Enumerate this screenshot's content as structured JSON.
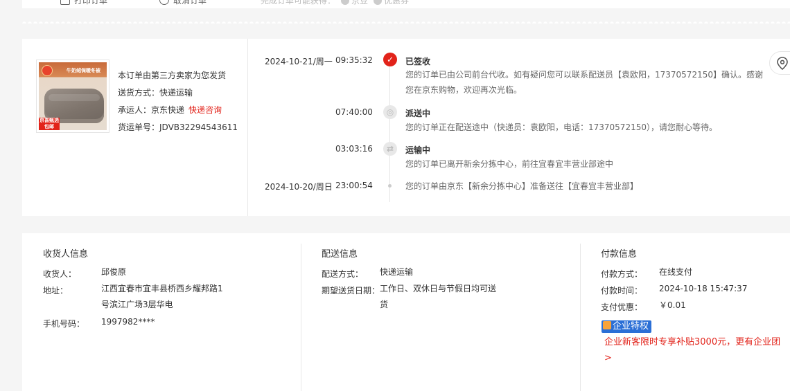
{
  "top_bar": {
    "print_label": "打印订单",
    "cancel_label": "取消订单",
    "reward_label": "完成订单可能获得：",
    "bean_label": "京豆",
    "coupon_label": "优惠券"
  },
  "product": {
    "banner_text": "牛奶绒保暖冬被",
    "tag_text": "京喜甄选 包邮",
    "seller_note": "本订单由第三方卖家为您发货",
    "delivery_method": "送货方式：快递运输",
    "carrier_label": "承运人：京东快递",
    "carrier_link": "快递咨询",
    "waybill": "货运单号：JDVB32294543611"
  },
  "timeline": [
    {
      "date": "2024-10-21/周一",
      "time": "09:35:32",
      "status": "已签收",
      "icon": "check-icon",
      "desc": "您的订单已由公司前台代收。如有疑问您可以联系配送员【袁欧阳，17370572150】确认。感谢您在京东购物，欢迎再次光临。"
    },
    {
      "date": "",
      "time": "07:40:00",
      "status": "派送中",
      "icon": "courier-icon",
      "desc": "您的订单正在配送途中（快递员：袁欧阳，电话：17370572150），请您耐心等待。"
    },
    {
      "date": "",
      "time": "03:03:16",
      "status": "运输中",
      "icon": "truck-icon",
      "desc": "您的订单已离开新余分拣中心，前往宜春宜丰营业部途中"
    },
    {
      "date": "2024-10-20/周日",
      "time": "23:00:54",
      "status": "",
      "icon": "dot",
      "desc": "您的订单由京东【新余分拣中心】准备送往【宜春宜丰营业部】"
    }
  ],
  "receiver": {
    "title": "收货人信息",
    "name_label": "收货人：",
    "name": "邱俊原",
    "address_label": "地址：",
    "address_line1": "江西宜春市宜丰县桥西乡耀邦路1",
    "address_line2": "号滨江广场3层华电",
    "phone_label": "手机号码：",
    "phone": "1997982****"
  },
  "delivery": {
    "title": "配送信息",
    "method_label": "配送方式：",
    "method": "快递运输",
    "date_label": "期望送货日期：",
    "date_line1": "工作日、双休日与节假日均可送",
    "date_line2": "货"
  },
  "payment": {
    "title": "付款信息",
    "method_label": "付款方式：",
    "method": "在线支付",
    "time_label": "付款时间：",
    "time": "2024-10-18 15:47:37",
    "discount_label": "支付优惠：",
    "discount": "￥0.01",
    "badge": "企业特权",
    "promo_line1": "企业新客限时专享补贴3000元，更有企业团",
    "promo_line2": ">"
  }
}
